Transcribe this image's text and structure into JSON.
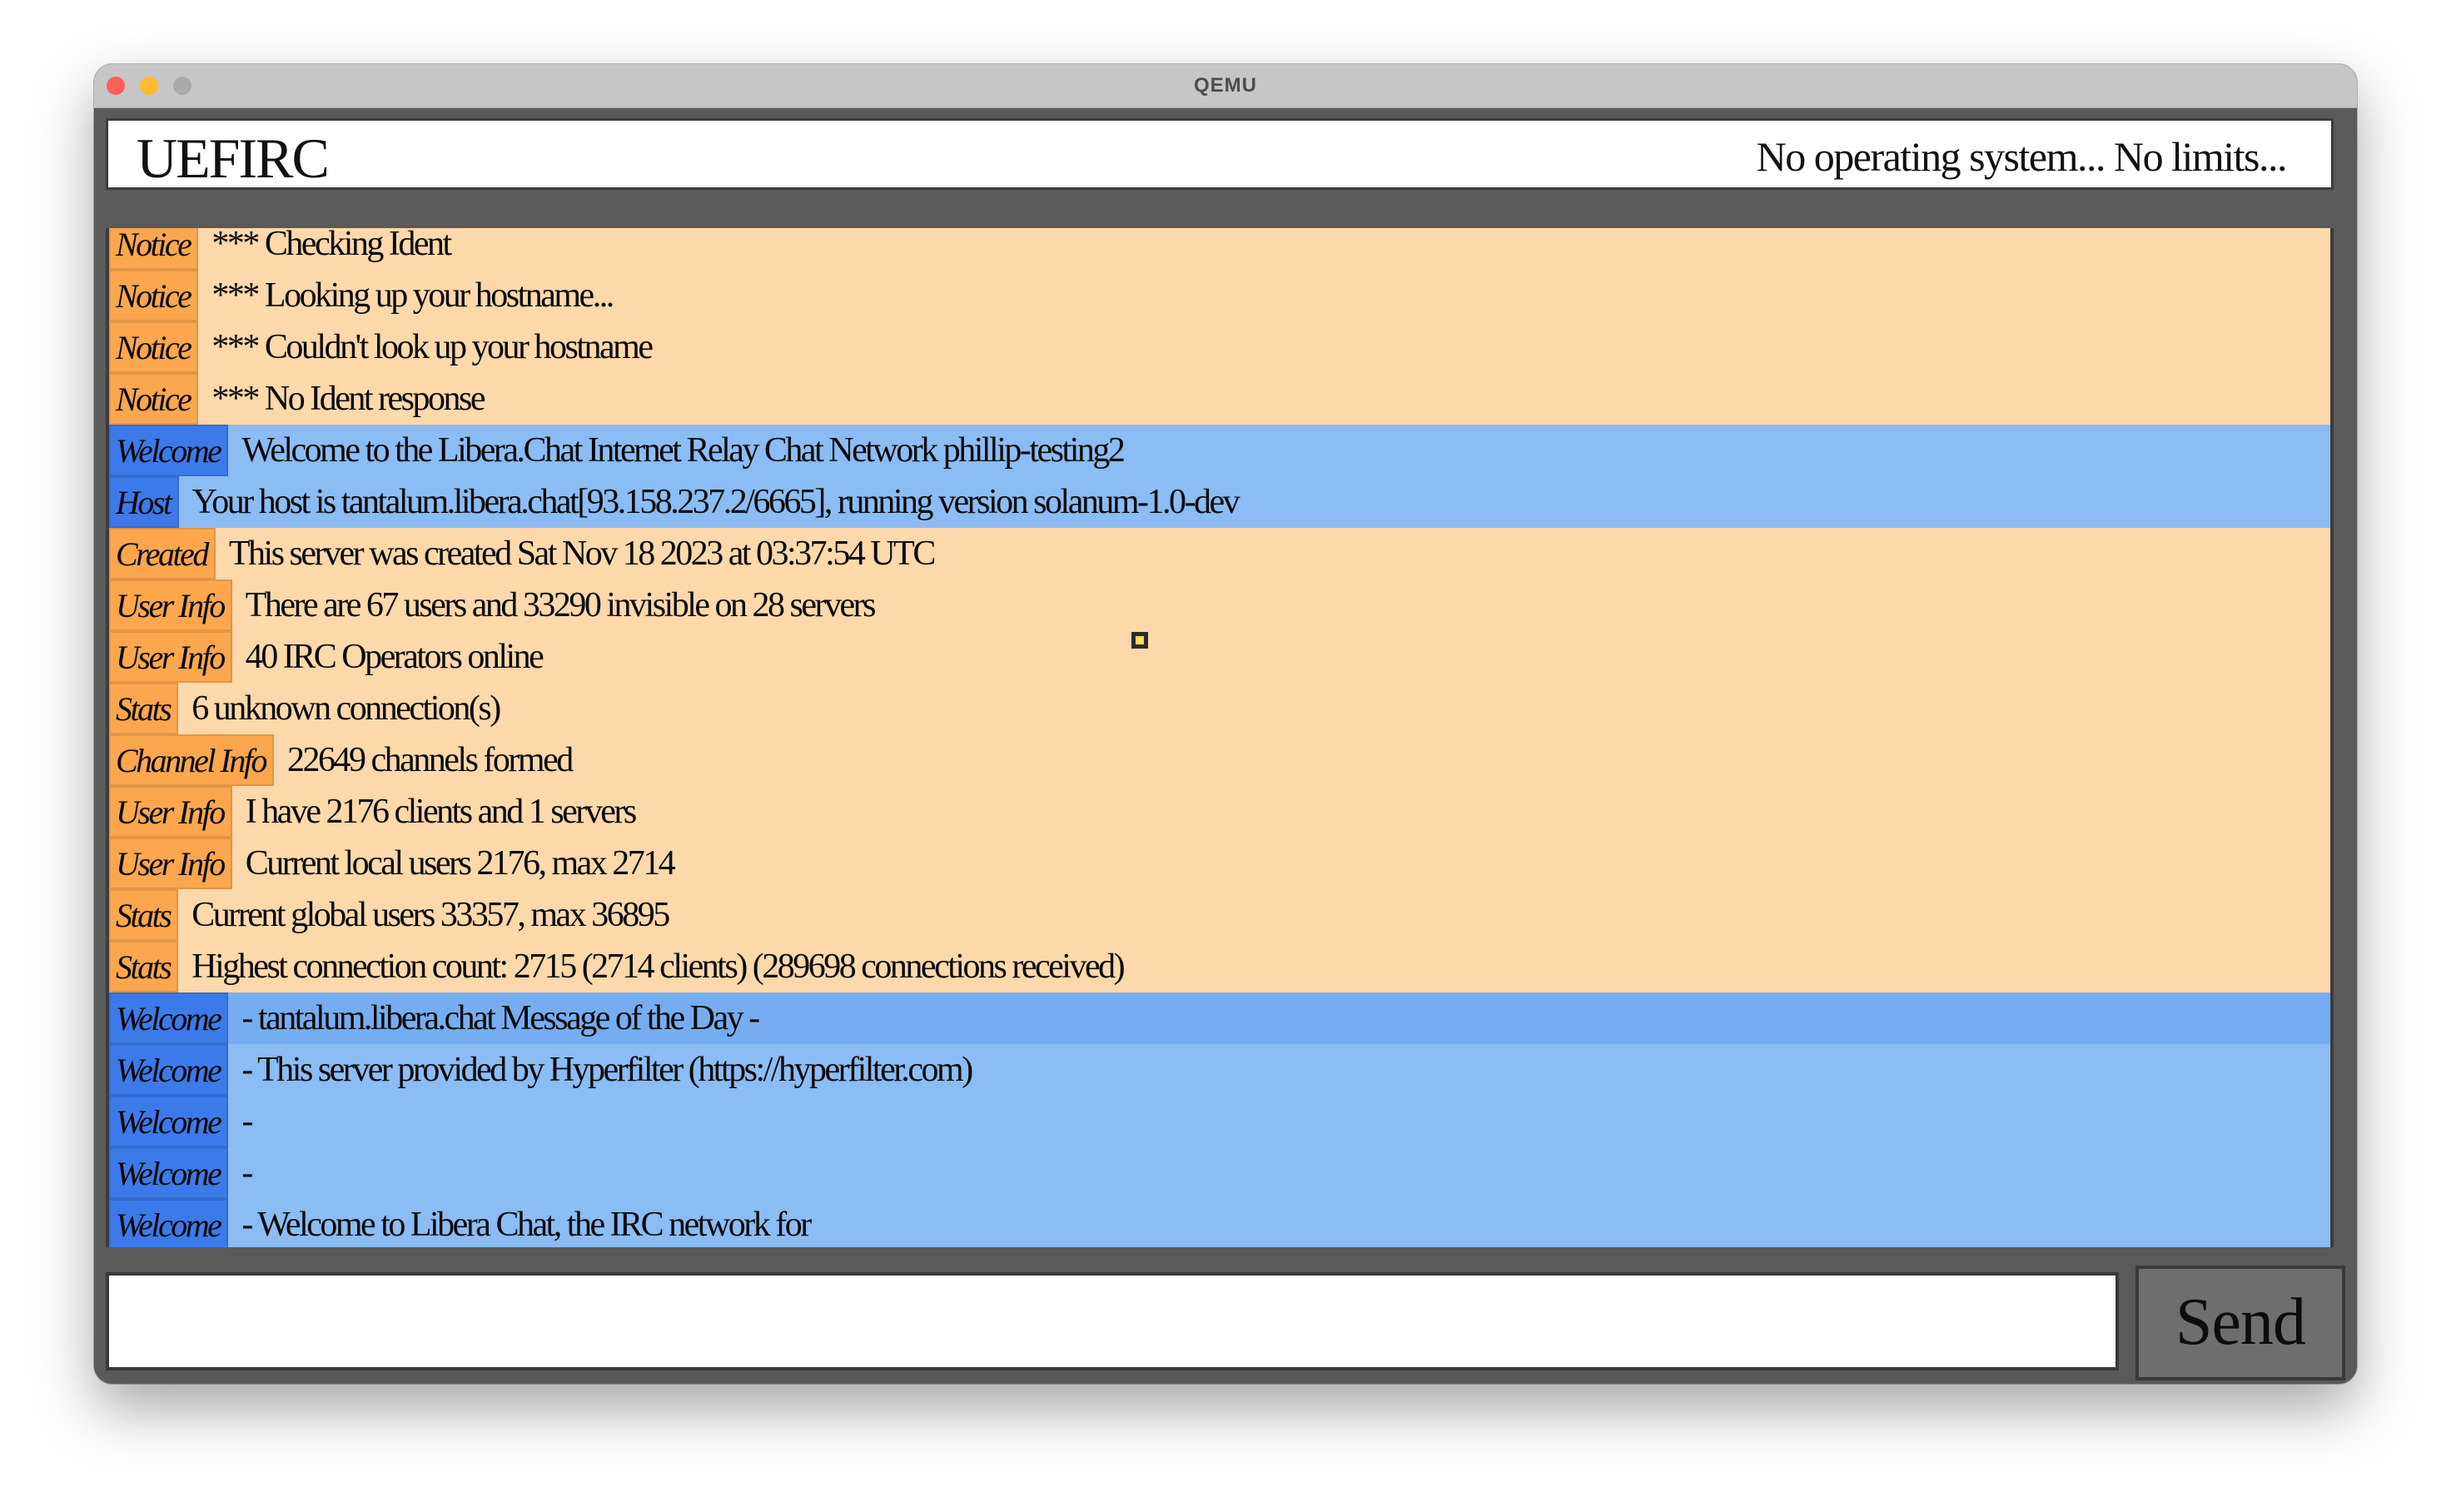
{
  "window": {
    "title": "QEMU"
  },
  "header": {
    "app_title": "UEFIRC",
    "tagline": "No operating system... No limits..."
  },
  "messages": [
    {
      "tag": "Notice",
      "text": "*** Checking Ident",
      "kind": "notice"
    },
    {
      "tag": "Notice",
      "text": "*** Looking up your hostname...",
      "kind": "notice"
    },
    {
      "tag": "Notice",
      "text": "*** Couldn't look up your hostname",
      "kind": "notice"
    },
    {
      "tag": "Notice",
      "text": "*** No Ident response",
      "kind": "notice"
    },
    {
      "tag": "Welcome",
      "text": "Welcome to the Libera.Chat Internet Relay Chat Network phillip-testing2",
      "kind": "welcome"
    },
    {
      "tag": "Host",
      "text": "Your host is tantalum.libera.chat[93.158.237.2/6665], running version solanum-1.0-dev",
      "kind": "welcome"
    },
    {
      "tag": "Created",
      "text": "This server was created Sat Nov 18 2023 at 03:37:54 UTC",
      "kind": "notice"
    },
    {
      "tag": "User Info",
      "text": "There are 67 users and 33290 invisible on 28 servers",
      "kind": "notice"
    },
    {
      "tag": "User Info",
      "text": "40 IRC Operators online",
      "kind": "notice"
    },
    {
      "tag": "Stats",
      "text": "6 unknown connection(s)",
      "kind": "notice"
    },
    {
      "tag": "Channel Info",
      "text": "22649 channels formed",
      "kind": "notice"
    },
    {
      "tag": "User Info",
      "text": "I have 2176 clients and 1 servers",
      "kind": "notice"
    },
    {
      "tag": "User Info",
      "text": "Current local users 2176, max 2714",
      "kind": "notice"
    },
    {
      "tag": "Stats",
      "text": "Current global users 33357, max 36895",
      "kind": "notice"
    },
    {
      "tag": "Stats",
      "text": "Highest connection count: 2715 (2714 clients) (289698 connections received)",
      "kind": "notice"
    },
    {
      "tag": "Welcome",
      "text": "- tantalum.libera.chat Message of the Day -",
      "kind": "welcome alt"
    },
    {
      "tag": "Welcome",
      "text": "- This server provided by Hyperfilter (https://hyperfilter.com)",
      "kind": "welcome"
    },
    {
      "tag": "Welcome",
      "text": "-",
      "kind": "welcome"
    },
    {
      "tag": "Welcome",
      "text": "-",
      "kind": "welcome"
    },
    {
      "tag": "Welcome",
      "text": "- Welcome to Libera Chat, the IRC network for",
      "kind": "welcome"
    }
  ],
  "input": {
    "value": "",
    "placeholder": ""
  },
  "send_button": {
    "label": "Send"
  }
}
